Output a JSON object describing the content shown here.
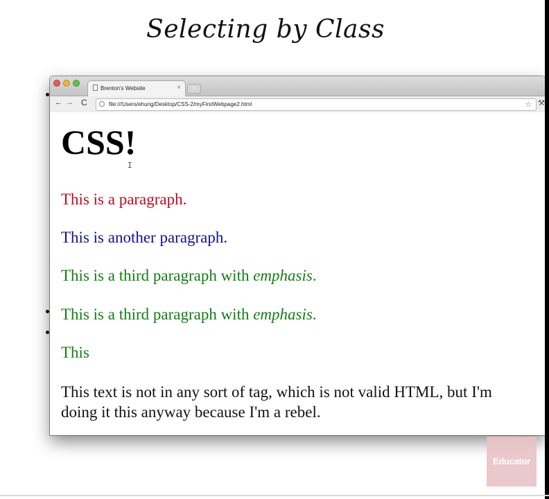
{
  "slide": {
    "title": "Selecting by Class",
    "watermark": "Educator"
  },
  "browser": {
    "tab_title": "Brenton's Website",
    "tab_close": "×",
    "new_tab": "+",
    "nav_back": "←",
    "nav_forward": "→",
    "nav_reload": "C",
    "url": "file:///Users/ehung/Desktop/CSS-2/myFirstWebpage2.html",
    "bookmark_star": "☆",
    "wrench": "⚒"
  },
  "page": {
    "heading": "CSS!",
    "cursor": "I",
    "paragraphs": [
      {
        "text": "This is a paragraph.",
        "color": "#c00a21"
      },
      {
        "text": "This is another paragraph.",
        "color": "#10109a"
      },
      {
        "text_before": "This is a third paragraph with ",
        "emphasis": "emphasis",
        "text_after": ".",
        "color": "#0f7f12"
      },
      {
        "text_before": "This is a third paragraph with ",
        "emphasis": "emphasis",
        "text_after": ".",
        "color": "#0f7f12"
      },
      {
        "text": "This",
        "color": "#0f7f12"
      },
      {
        "text": "This text is not in any sort of tag, which is not valid HTML, but I'm doing it this anyway because I'm a rebel.",
        "color": "#111111"
      }
    ]
  },
  "icons": {
    "close": "close-window-icon",
    "minimize": "minimize-window-icon",
    "maximize": "maximize-window-icon",
    "page": "page-icon",
    "globe": "globe-icon",
    "star": "star-icon",
    "wrench": "wrench-icon"
  }
}
